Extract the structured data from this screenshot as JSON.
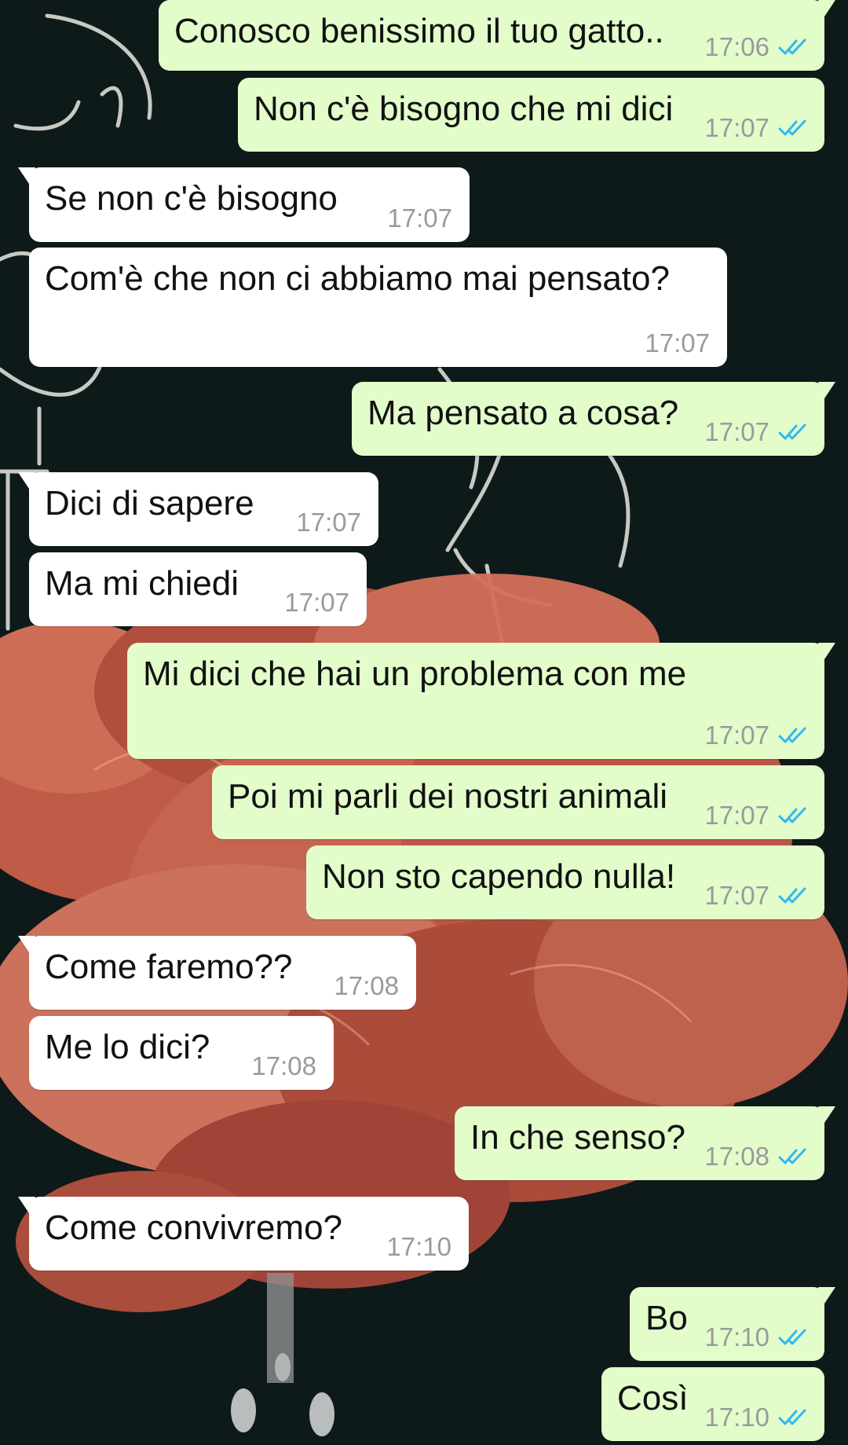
{
  "colors": {
    "incoming_bubble": "#ffffff",
    "outgoing_bubble": "#e2fdca",
    "timestamp": "#9a9a9a",
    "read_ticks": "#34b7f1",
    "wallpaper_dark": "#0e1a1a",
    "wallpaper_flower": "#d9725a"
  },
  "icons": {
    "read_status": "double-check-icon"
  },
  "messages": [
    {
      "direction": "out",
      "text": "Conosco benissimo il tuo gatto..",
      "time": "17:06",
      "status": "read"
    },
    {
      "direction": "out",
      "text": "Non c'è bisogno che mi dici",
      "time": "17:07",
      "status": "read"
    },
    {
      "direction": "in",
      "text": "Se non c'è bisogno",
      "time": "17:07"
    },
    {
      "direction": "in",
      "text": "Com'è che non ci abbiamo mai pensato?",
      "time": "17:07"
    },
    {
      "direction": "out",
      "text": "Ma pensato a cosa?",
      "time": "17:07",
      "status": "read"
    },
    {
      "direction": "in",
      "text": "Dici di sapere",
      "time": "17:07"
    },
    {
      "direction": "in",
      "text": "Ma mi chiedi",
      "time": "17:07"
    },
    {
      "direction": "out",
      "text": "Mi dici che hai un problema con me",
      "time": "17:07",
      "status": "read"
    },
    {
      "direction": "out",
      "text": "Poi mi parli dei nostri animali",
      "time": "17:07",
      "status": "read"
    },
    {
      "direction": "out",
      "text": "Non sto capendo nulla!",
      "time": "17:07",
      "status": "read"
    },
    {
      "direction": "in",
      "text": "Come faremo??",
      "time": "17:08"
    },
    {
      "direction": "in",
      "text": "Me lo dici?",
      "time": "17:08"
    },
    {
      "direction": "out",
      "text": "In che senso?",
      "time": "17:08",
      "status": "read"
    },
    {
      "direction": "in",
      "text": "Come convivremo?",
      "time": "17:10"
    },
    {
      "direction": "out",
      "text": "Bo",
      "time": "17:10",
      "status": "read"
    },
    {
      "direction": "out",
      "text": "Così",
      "time": "17:10",
      "status": "read"
    }
  ]
}
